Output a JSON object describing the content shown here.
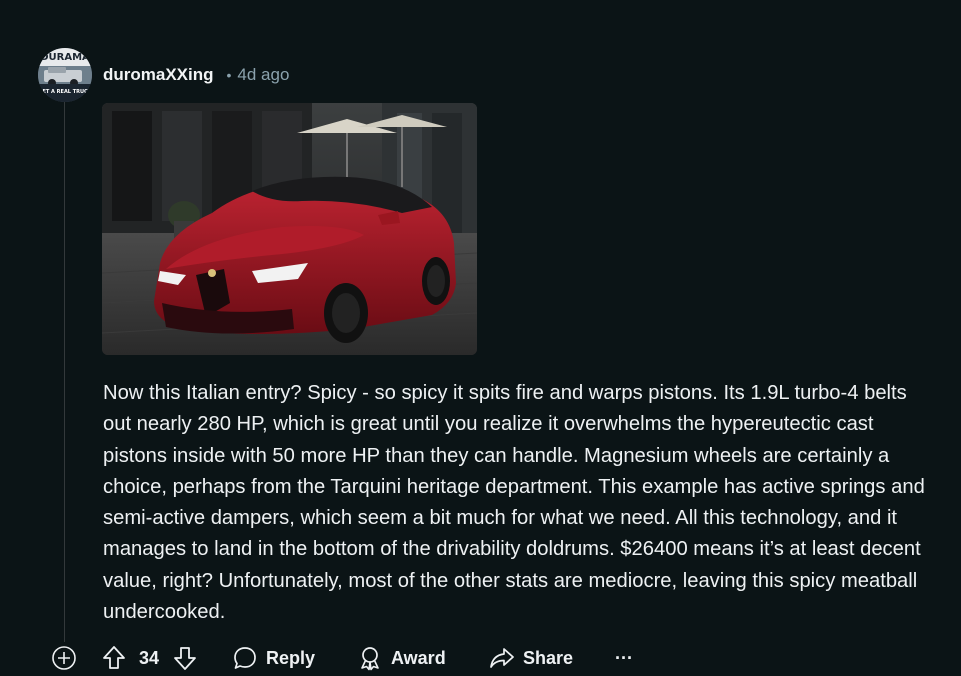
{
  "comment": {
    "author": "duromaXXing",
    "separator": "•",
    "time": "4d ago",
    "avatar_icon": "pickup-truck-avatar",
    "image_icon": "red-sedan-photo",
    "body": "Now this Italian entry? Spicy - so spicy it spits fire and warps pistons. Its 1.9L turbo-4 belts out nearly 280 HP, which is great until you realize it overwhelms the hypereutectic cast pistons inside with 50 more HP than they can handle. Magnesium wheels are certainly a choice, perhaps from the Tarquini heritage department. This example has active springs and semi-active dampers, which seem a bit much for what we need. All this technology, and it manages to land in the bottom of the drivability doldrums. $26400 means it’s at least decent value, right? Unfortunately, most of the other stats are mediocre, leaving this spicy meatball undercooked."
  },
  "actions": {
    "vote_count": "34",
    "reply_label": "Reply",
    "award_label": "Award",
    "share_label": "Share",
    "more_label": "···"
  },
  "colors": {
    "background": "#0b1416",
    "text": "#f2f4f5",
    "muted": "#8ba2ad",
    "car_red": "#9a1620"
  }
}
